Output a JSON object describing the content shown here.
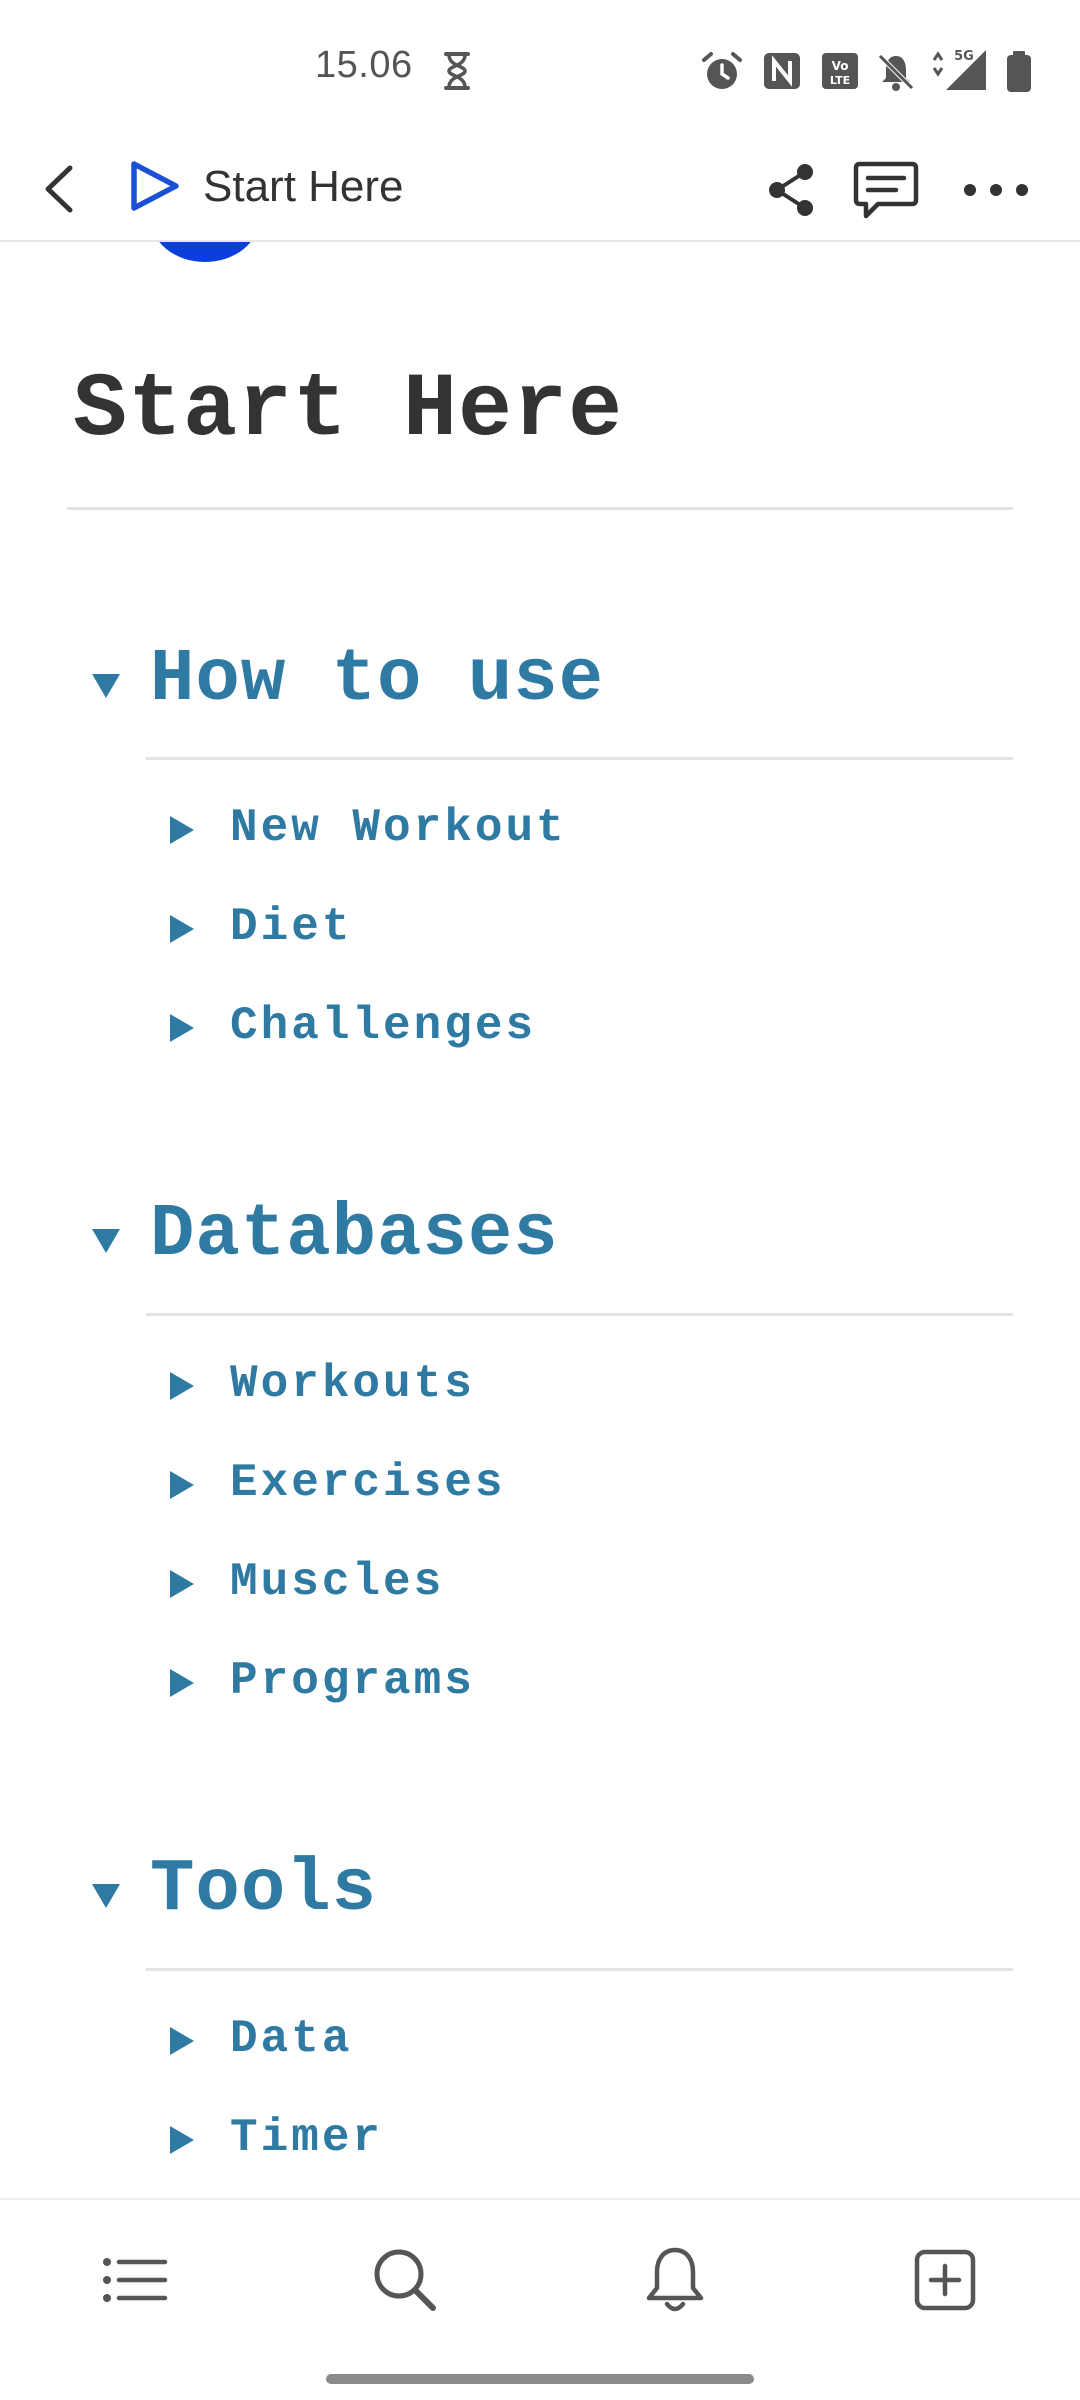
{
  "status_bar": {
    "time": "15.06",
    "icons": [
      "hourglass-icon",
      "alarm-icon",
      "nfc-icon",
      "volte-icon",
      "bell-off-icon",
      "signal-5g-icon",
      "battery-icon"
    ],
    "network_label": "5G"
  },
  "app_bar": {
    "title": "Start Here",
    "page_icon": "play-outline-icon",
    "actions": [
      "share-icon",
      "comment-icon",
      "more-icon"
    ]
  },
  "page": {
    "title": "Start Here",
    "cover_icon_color": "#0a3fdc",
    "sections": [
      {
        "heading": "How to use",
        "expanded": true,
        "items": [
          "New Workout",
          "Diet",
          "Challenges"
        ]
      },
      {
        "heading": "Databases",
        "expanded": true,
        "items": [
          "Workouts",
          "Exercises",
          "Muscles",
          "Programs"
        ]
      },
      {
        "heading": "Tools",
        "expanded": true,
        "items": [
          "Data",
          "Timer"
        ]
      }
    ]
  },
  "bottom_nav": {
    "items": [
      "list-icon",
      "search-icon",
      "bell-icon",
      "add-page-icon"
    ]
  },
  "colors": {
    "accent": "#2f7aa3",
    "title_text": "#333333",
    "page_icon_blue": "#1b4fd6"
  }
}
